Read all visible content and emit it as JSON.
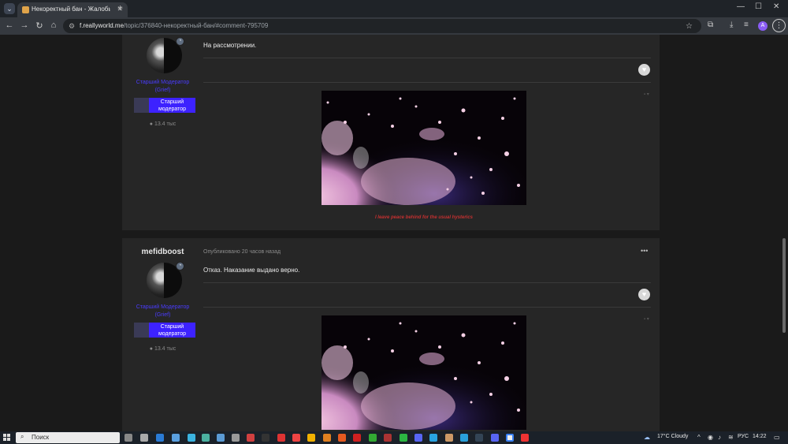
{
  "browser": {
    "tab_title": "Некоректный бан - Жалобы",
    "url_host": "f.reallyworld.me",
    "url_path": "/topic/376840-некоректный-бан/#comment-795709"
  },
  "posts": [
    {
      "author": "",
      "rank_line1": "Старший Модератор",
      "rank_line2": "(Grief)",
      "group_line1": "Старший",
      "group_line2": "модератор",
      "reputation": "13.4 тыс",
      "meta": "",
      "body": "На рассмотрении.",
      "signature": "I leave peace behind for the usual hysterics"
    },
    {
      "author": "mefidboost",
      "rank_line1": "Старший Модератор",
      "rank_line2": "(Grief)",
      "group_line1": "Старший",
      "group_line2": "модератор",
      "reputation": "13.4 тыс",
      "meta": "Опубликовано 20 часов назад",
      "body": "Отказ. Наказание выдано верно.",
      "signature": ""
    }
  ],
  "icons": {
    "reputation": "comment-icon",
    "like": "heart-icon",
    "menu": "ellipsis-icon"
  },
  "taskbar": {
    "search_placeholder": "Поиск",
    "weather": "17°C  Cloudy",
    "language": "РУС",
    "time": "14:22"
  },
  "colors": {
    "rank_text": "#4a3cff",
    "group_badge": "#3d22ff",
    "signature_text": "#c33030"
  }
}
